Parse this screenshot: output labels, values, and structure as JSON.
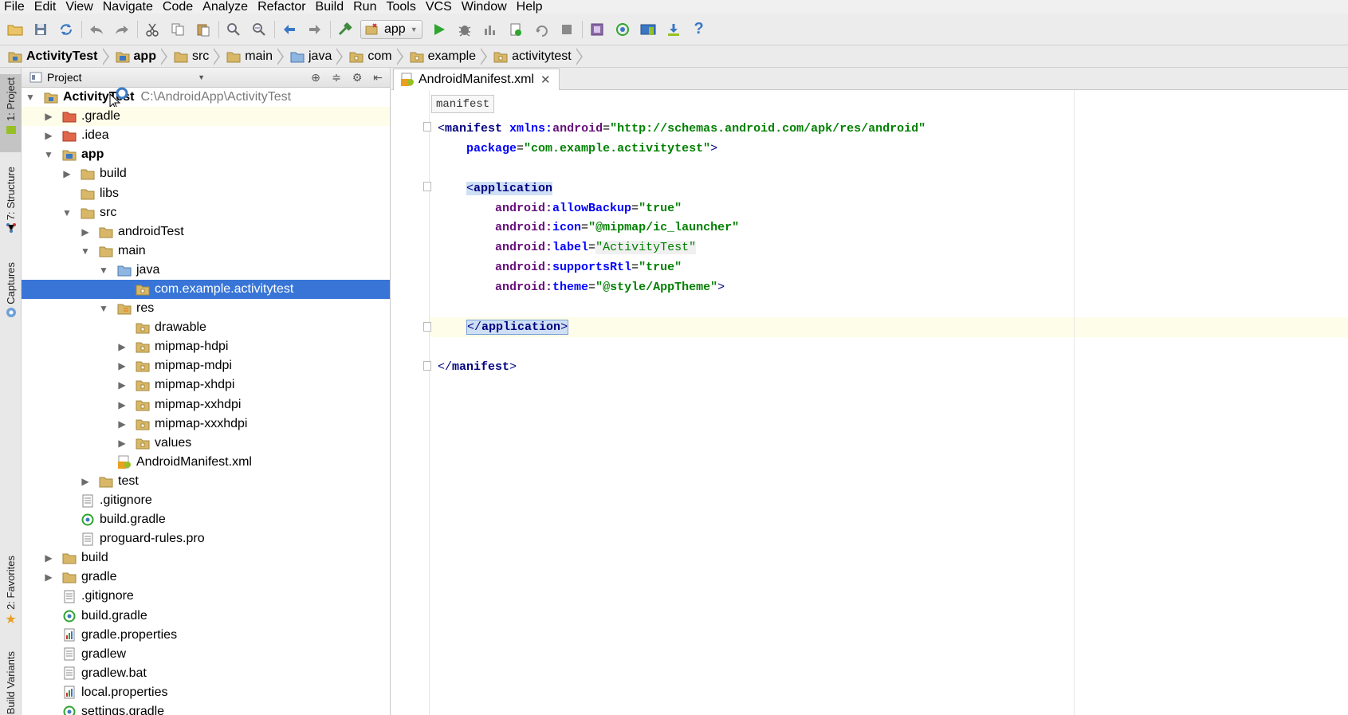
{
  "menu": [
    "File",
    "Edit",
    "View",
    "Navigate",
    "Code",
    "Analyze",
    "Refactor",
    "Build",
    "Run",
    "Tools",
    "VCS",
    "Window",
    "Help"
  ],
  "toolbar": {
    "run_config": "app",
    "help": "?"
  },
  "breadcrumb": [
    "ActivityTest",
    "app",
    "src",
    "main",
    "java",
    "com",
    "example",
    "activitytest"
  ],
  "left_stripe": {
    "project": "1: Project",
    "structure": "7: Structure",
    "captures": "Captures",
    "favorites": "2: Favorites",
    "build_variants": "Build Variants"
  },
  "project_panel": {
    "view": "Project",
    "root_name": "ActivityTest",
    "root_path": "C:\\AndroidApp\\ActivityTest",
    "tree": [
      {
        "label": ".gradle"
      },
      {
        "label": ".idea"
      },
      {
        "label": "app"
      },
      {
        "label": "build"
      },
      {
        "label": "libs"
      },
      {
        "label": "src"
      },
      {
        "label": "androidTest"
      },
      {
        "label": "main"
      },
      {
        "label": "java"
      },
      {
        "label": "com.example.activitytest"
      },
      {
        "label": "res"
      },
      {
        "label": "drawable"
      },
      {
        "label": "mipmap-hdpi"
      },
      {
        "label": "mipmap-mdpi"
      },
      {
        "label": "mipmap-xhdpi"
      },
      {
        "label": "mipmap-xxhdpi"
      },
      {
        "label": "mipmap-xxxhdpi"
      },
      {
        "label": "values"
      },
      {
        "label": "AndroidManifest.xml"
      },
      {
        "label": "test"
      },
      {
        "label": ".gitignore"
      },
      {
        "label": "build.gradle"
      },
      {
        "label": "proguard-rules.pro"
      },
      {
        "label": "build"
      },
      {
        "label": "gradle"
      },
      {
        "label": ".gitignore"
      },
      {
        "label": "build.gradle"
      },
      {
        "label": "gradle.properties"
      },
      {
        "label": "gradlew"
      },
      {
        "label": "gradlew.bat"
      },
      {
        "label": "local.properties"
      },
      {
        "label": "settings.gradle"
      }
    ]
  },
  "editor": {
    "tab": "AndroidManifest.xml",
    "breadcrumb_hint": "manifest",
    "code": {
      "l1_tag": "manifest",
      "l1_attr_ns": "xmlns:",
      "l1_attr": "android",
      "l1_val": "\"http://schemas.android.com/apk/res/android\"",
      "l2_attr": "package",
      "l2_val": "\"com.example.activitytest\"",
      "app_tag": "application",
      "a1_attr": "allowBackup",
      "a1_val": "\"true\"",
      "a2_attr": "icon",
      "a2_val": "\"@mipmap/ic_launcher\"",
      "a3_attr": "label",
      "a3_val": "\"ActivityTest\"",
      "a4_attr": "supportsRtl",
      "a4_val": "\"true\"",
      "a5_attr": "theme",
      "a5_val": "\"@style/AppTheme\"",
      "app_close": "application",
      "manifest_close": "manifest",
      "ns_prefix": "android:"
    }
  },
  "colors": {
    "selection": "#3875d7",
    "folder": "#d8b769",
    "android_green": "#97c024"
  }
}
